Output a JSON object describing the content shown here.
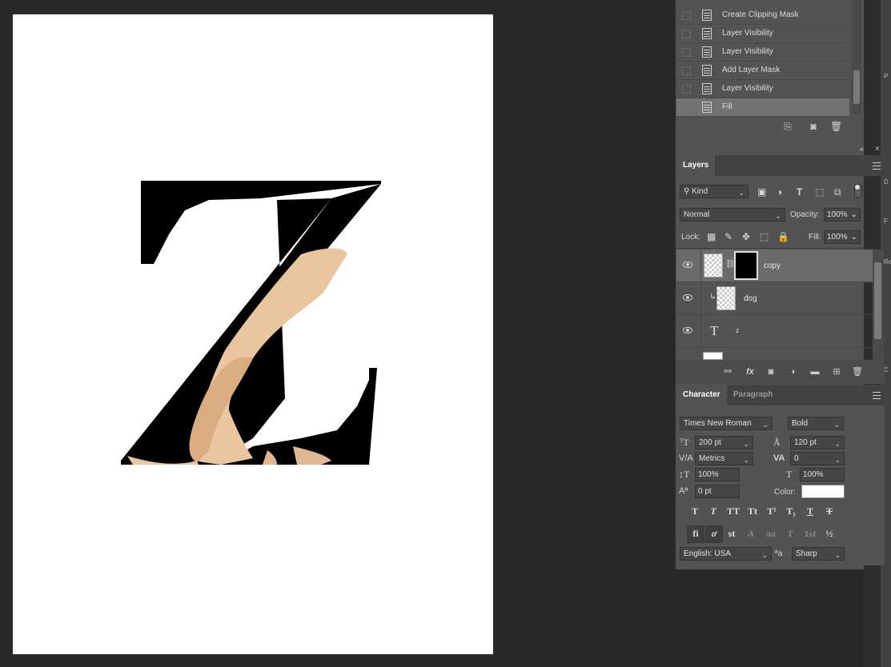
{
  "history": {
    "items": [
      {
        "label": "Create Clipping Mask",
        "selected": false
      },
      {
        "label": "Layer Visibility",
        "selected": false
      },
      {
        "label": "Layer Visibility",
        "selected": false
      },
      {
        "label": "Add Layer Mask",
        "selected": false
      },
      {
        "label": "Layer Visibility",
        "selected": false
      },
      {
        "label": "Fill",
        "selected": true
      }
    ]
  },
  "layers": {
    "tab_label": "Layers",
    "filter_kind": "Kind",
    "blend_mode": "Normal",
    "opacity_label": "Opacity:",
    "opacity_value": "100%",
    "lock_label": "Lock:",
    "fill_label": "Fill:",
    "fill_value": "100%",
    "items": [
      {
        "name": "copy",
        "selected": true
      },
      {
        "name": "dog",
        "selected": false
      },
      {
        "name": "z",
        "selected": false
      }
    ]
  },
  "character": {
    "tab_active": "Character",
    "tab_inactive": "Paragraph",
    "font_family": "Times New Roman",
    "font_style": "Bold",
    "font_size": "200 pt",
    "leading": "120 pt",
    "kerning": "Metrics",
    "tracking": "0",
    "vertical_scale": "100%",
    "horizontal_scale": "100%",
    "baseline_shift": "0 pt",
    "color_label": "Color:",
    "color_value": "#ffffff",
    "language": "English: USA",
    "aa_glyph": "ªa",
    "antialias": "Sharp",
    "type_buttons": [
      "T",
      "T",
      "TT",
      "Tt",
      "T¹",
      "T₁",
      "T",
      "T"
    ],
    "opentype_buttons": [
      "fi",
      "ơ",
      "st",
      "A",
      "aa",
      "T",
      "1st",
      "½"
    ]
  },
  "canvas": {
    "letter": "Z",
    "letter_font": "Times New Roman Bold",
    "background": "#ffffff",
    "letter_color": "#000000"
  },
  "right_dock": {
    "chars": [
      "P",
      "D",
      "F",
      "Re",
      "C"
    ]
  }
}
